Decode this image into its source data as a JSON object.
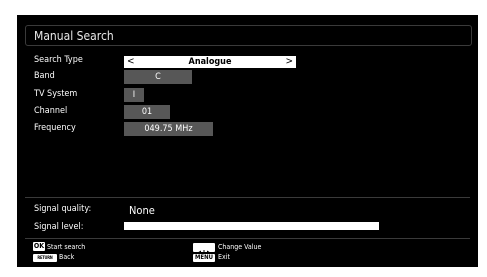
{
  "title": "Manual Search",
  "fields": [
    {
      "label": "Search Type",
      "value": "Analogue"
    },
    {
      "label": "Band",
      "value": "C"
    },
    {
      "label": "TV System",
      "value": "I"
    },
    {
      "label": "Channel",
      "value": "01"
    },
    {
      "label": "Frequency",
      "value": "049.75 MHz"
    }
  ],
  "selector_arrows": {
    "left": "<",
    "right": ">"
  },
  "signal": {
    "quality_label": "Signal quality:",
    "quality_value": "None",
    "level_label": "Signal level:",
    "level_fraction": 1.0
  },
  "legend": {
    "ok_key": "OK",
    "ok_text": "Start search",
    "return_key": "RETURN",
    "return_text": "Back",
    "arrows_text": "Change Value",
    "menu_key": "MENU",
    "menu_text": "Exit"
  },
  "colors": {
    "background": "#000000",
    "field": "#575757",
    "highlight": "#ffffff"
  }
}
